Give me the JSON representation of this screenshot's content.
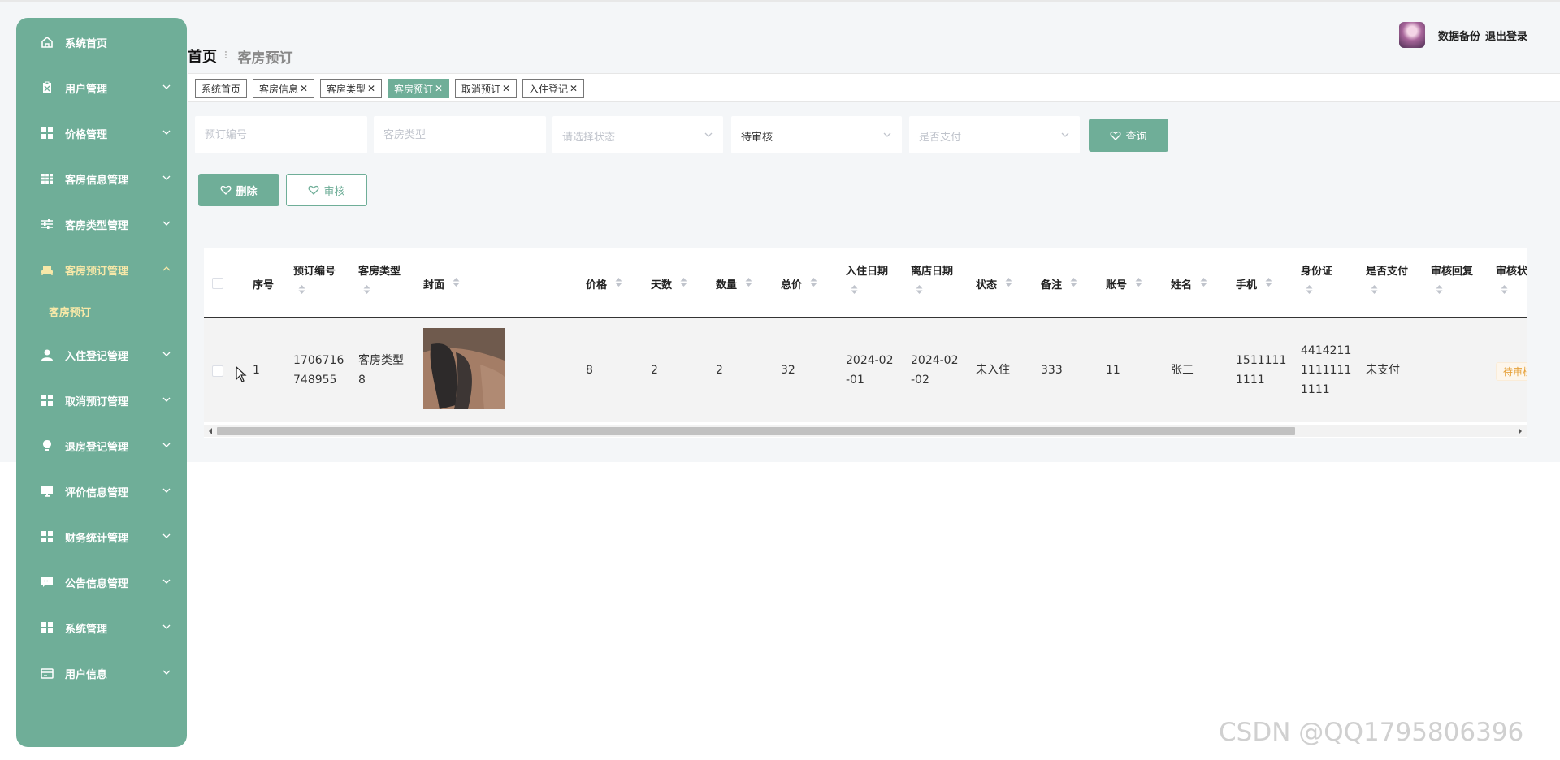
{
  "sidebar": {
    "items": [
      {
        "label": "系统首页",
        "icon": "home-icon"
      },
      {
        "label": "用户管理",
        "icon": "user-doc-icon"
      },
      {
        "label": "价格管理",
        "icon": "grid-icon"
      },
      {
        "label": "客房信息管理",
        "icon": "table-icon"
      },
      {
        "label": "客房类型管理",
        "icon": "sliders-icon"
      },
      {
        "label": "客房预订管理",
        "icon": "bed-icon"
      },
      {
        "label": "入住登记管理",
        "icon": "person-icon"
      },
      {
        "label": "取消预订管理",
        "icon": "grid-icon"
      },
      {
        "label": "退房登记管理",
        "icon": "bulb-icon"
      },
      {
        "label": "评价信息管理",
        "icon": "monitor-icon"
      },
      {
        "label": "财务统计管理",
        "icon": "grid-icon"
      },
      {
        "label": "公告信息管理",
        "icon": "chat-icon"
      },
      {
        "label": "系统管理",
        "icon": "grid-icon"
      },
      {
        "label": "用户信息",
        "icon": "card-icon"
      }
    ],
    "submenu": {
      "label": "客房预订"
    }
  },
  "header": {
    "breadcrumb_home": "首页",
    "breadcrumb_sep": "⠇",
    "breadcrumb_current": "客房预订",
    "backup_label": "数据备份",
    "logout_label": "退出登录"
  },
  "tags": [
    {
      "label": "系统首页",
      "closable": false
    },
    {
      "label": "客房信息",
      "closable": true
    },
    {
      "label": "客房类型",
      "closable": true
    },
    {
      "label": "客房预订",
      "closable": true,
      "active": true
    },
    {
      "label": "取消预订",
      "closable": true
    },
    {
      "label": "入住登记",
      "closable": true
    }
  ],
  "filters": {
    "order_no_placeholder": "预订编号",
    "room_type_placeholder": "客房类型",
    "status_placeholder": "请选择状态",
    "audit_value": "待审核",
    "paid_placeholder": "是否支付",
    "query_label": "查询"
  },
  "actions": {
    "delete_label": "删除",
    "audit_label": "审核"
  },
  "table": {
    "columns": [
      "序号",
      "预订编号",
      "客房类型",
      "封面",
      "价格",
      "天数",
      "数量",
      "总价",
      "入住日期",
      "离店日期",
      "状态",
      "备注",
      "账号",
      "姓名",
      "手机",
      "身份证",
      "是否支付",
      "审核回复",
      "审核状"
    ],
    "row": {
      "index": "1",
      "order_no_1": "1706716",
      "order_no_2": "748955",
      "room_type_1": "客房类型",
      "room_type_2": "8",
      "price": "8",
      "days": "2",
      "quantity": "2",
      "total": "32",
      "checkin_1": "2024-02",
      "checkin_2": "-01",
      "checkout_1": "2024-02",
      "checkout_2": "-02",
      "status": "未入住",
      "remark": "333",
      "account": "11",
      "name": "张三",
      "phone_1": "1511111",
      "phone_2": "1111",
      "id_1": "4414211",
      "id_2": "1111111",
      "id_3": "1111",
      "paid": "未支付",
      "audit_reply": "",
      "audit_status": "待审核"
    }
  },
  "watermark": "CSDN @QQ1795806396",
  "colors": {
    "accent": "#6fae98",
    "submenu_text": "#f7e8a8",
    "warning": "#e6a23c"
  }
}
